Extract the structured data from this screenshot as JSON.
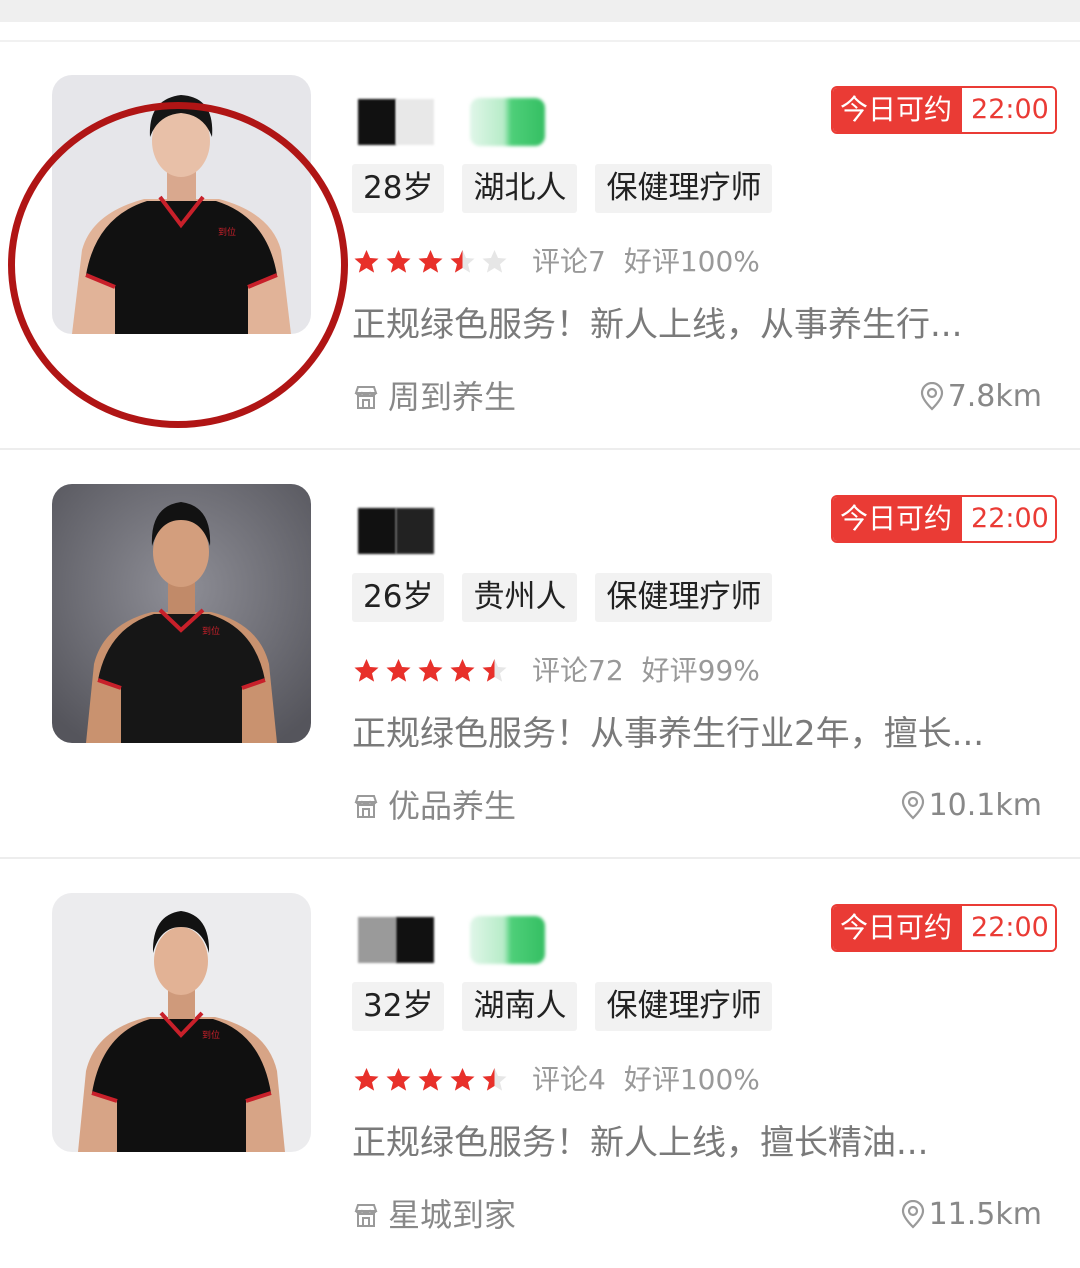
{
  "therapists": [
    {
      "available_label": "今日可约",
      "time": "22:00",
      "tags": [
        "28岁",
        "湖北人",
        "保健理疗师"
      ],
      "rating": 3.5,
      "reviews": "评论7",
      "positive": "好评100%",
      "description": "正规绿色服务！新人上线，从事养生行...",
      "shop": "周到养生",
      "distance": "7.8km",
      "highlighted": true,
      "shirt_logo": "到位"
    },
    {
      "available_label": "今日可约",
      "time": "22:00",
      "tags": [
        "26岁",
        "贵州人",
        "保健理疗师"
      ],
      "rating": 4.5,
      "reviews": "评论72",
      "positive": "好评99%",
      "description": "正规绿色服务！从事养生行业2年，擅长...",
      "shop": "优品养生",
      "distance": "10.1km",
      "highlighted": false,
      "shirt_logo": "到位"
    },
    {
      "available_label": "今日可约",
      "time": "22:00",
      "tags": [
        "32岁",
        "湖南人",
        "保健理疗师"
      ],
      "rating": 4.5,
      "reviews": "评论4",
      "positive": "好评100%",
      "description": "正规绿色服务！新人上线，擅长精油...",
      "shop": "星城到家",
      "distance": "11.5km",
      "highlighted": false,
      "shirt_logo": "到位"
    }
  ],
  "colors": {
    "accent": "#ea3b35",
    "star": "#e8302a",
    "star_empty": "#e6e6e6",
    "ring": "#b01515"
  },
  "icons": {
    "shop": "storefront-icon",
    "distance": "location-pin-icon"
  }
}
